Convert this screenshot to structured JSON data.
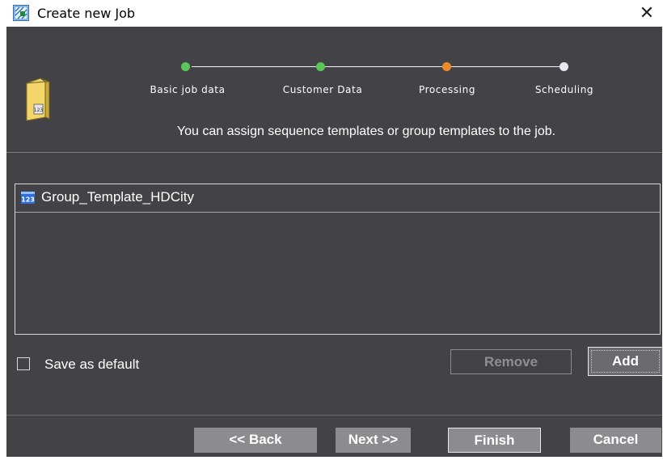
{
  "window": {
    "title": "Create new Job",
    "close_glyph": "✕"
  },
  "wizard": {
    "steps": [
      {
        "label": "Basic job data",
        "status": "completed",
        "color": "#5ac65a"
      },
      {
        "label": "Customer Data",
        "status": "completed",
        "color": "#5ac65a"
      },
      {
        "label": "Processing",
        "status": "current",
        "color": "#f08c28"
      },
      {
        "label": "Scheduling",
        "status": "pending",
        "color": "#e8e8ee"
      }
    ],
    "description": "You can assign sequence templates or group templates to the job."
  },
  "templates": {
    "items": [
      {
        "label": "Group_Template_HDCity",
        "icon": "group-template-icon"
      }
    ]
  },
  "options": {
    "save_default_label": "Save as default",
    "save_default_checked": false
  },
  "buttons": {
    "remove": "Remove",
    "add": "Add",
    "back": "<< Back",
    "next": "Next >>",
    "finish": "Finish",
    "cancel": "Cancel"
  },
  "colors": {
    "background": "#434347",
    "button": "#8c8c90",
    "accent_completed": "#5ac65a",
    "accent_current": "#f08c28"
  }
}
